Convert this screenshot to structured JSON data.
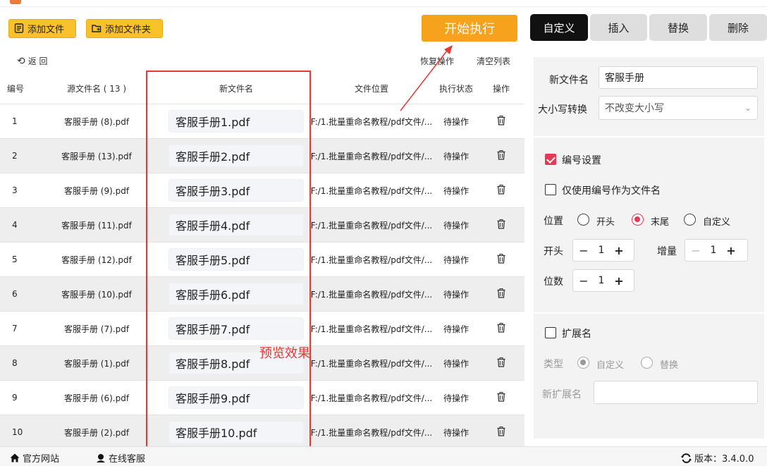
{
  "toolbar": {
    "add_file": "添加文件",
    "add_folder": "添加文件夹",
    "start": "开始执行",
    "back": "返 回",
    "restore": "恢复操作",
    "clear_list": "清空列表"
  },
  "table": {
    "headers": {
      "no": "编号",
      "source": "源文件名 ( 13 )",
      "new_name": "新文件名",
      "location": "文件位置",
      "status": "执行状态",
      "action": "操作"
    },
    "rows": [
      {
        "no": "1",
        "source": "客服手册 (8).pdf",
        "new_name": "客服手册1.pdf",
        "location": "F:/1.批量重命名教程/pdf文件/...",
        "status": "待操作"
      },
      {
        "no": "2",
        "source": "客服手册 (13).pdf",
        "new_name": "客服手册2.pdf",
        "location": "F:/1.批量重命名教程/pdf文件/...",
        "status": "待操作"
      },
      {
        "no": "3",
        "source": "客服手册 (9).pdf",
        "new_name": "客服手册3.pdf",
        "location": "F:/1.批量重命名教程/pdf文件/...",
        "status": "待操作"
      },
      {
        "no": "4",
        "source": "客服手册 (11).pdf",
        "new_name": "客服手册4.pdf",
        "location": "F:/1.批量重命名教程/pdf文件/...",
        "status": "待操作"
      },
      {
        "no": "5",
        "source": "客服手册 (12).pdf",
        "new_name": "客服手册5.pdf",
        "location": "F:/1.批量重命名教程/pdf文件/...",
        "status": "待操作"
      },
      {
        "no": "6",
        "source": "客服手册 (10).pdf",
        "new_name": "客服手册6.pdf",
        "location": "F:/1.批量重命名教程/pdf文件/...",
        "status": "待操作"
      },
      {
        "no": "7",
        "source": "客服手册 (7).pdf",
        "new_name": "客服手册7.pdf",
        "location": "F:/1.批量重命名教程/pdf文件/...",
        "status": "待操作"
      },
      {
        "no": "8",
        "source": "客服手册 (1).pdf",
        "new_name": "客服手册8.pdf",
        "location": "F:/1.批量重命名教程/pdf文件/...",
        "status": "待操作"
      },
      {
        "no": "9",
        "source": "客服手册 (6).pdf",
        "new_name": "客服手册9.pdf",
        "location": "F:/1.批量重命名教程/pdf文件/...",
        "status": "待操作"
      },
      {
        "no": "10",
        "source": "客服手册 (2).pdf",
        "new_name": "客服手册10.pdf",
        "location": "F:/1.批量重命名教程/pdf文件/...",
        "status": "待操作"
      }
    ]
  },
  "annotation": {
    "preview_label": "预览效果"
  },
  "right_tabs": {
    "custom": "自定义",
    "insert": "插入",
    "replace": "替换",
    "delete": "删除"
  },
  "panel": {
    "new_name_label": "新文件名",
    "new_name_value": "客服手册",
    "case_label": "大小写转换",
    "case_value": "不改变大小写",
    "number_setting": "编号设置",
    "number_only": "仅使用编号作为文件名",
    "position_label": "位置",
    "pos_start": "开头",
    "pos_end": "末尾",
    "pos_custom": "自定义",
    "start_label": "开头",
    "start_value": "1",
    "increment_label": "增量",
    "increment_value": "1",
    "digits_label": "位数",
    "digits_value": "1",
    "ext_label": "扩展名",
    "type_label": "类型",
    "type_custom": "自定义",
    "type_replace": "替换",
    "new_ext_label": "新扩展名",
    "new_ext_value": ""
  },
  "footer": {
    "website": "官方网站",
    "support": "在线客服",
    "version": "版本：3.4.0.0"
  },
  "colors": {
    "accent_yellow": "#f9c22b",
    "start_orange": "#f7a21c",
    "annotation_red": "#e53935",
    "check_red": "#e53955"
  }
}
